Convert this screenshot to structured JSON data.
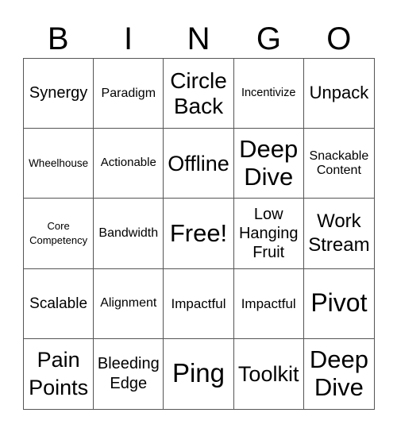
{
  "header": [
    "B",
    "I",
    "N",
    "G",
    "O"
  ],
  "cells": [
    [
      "Synergy",
      "Paradigm",
      "Circle Back",
      "Incentivize",
      "Unpack"
    ],
    [
      "Wheelhouse",
      "Actionable",
      "Offline",
      "Deep Dive",
      "Snackable Content"
    ],
    [
      "Core Competency",
      "Bandwidth",
      "Free!",
      "Low Hanging Fruit",
      "Work Stream"
    ],
    [
      "Scalable",
      "Alignment",
      "Impactful",
      "Impactful",
      "Pivot"
    ],
    [
      "Pain Points",
      "Bleeding Edge",
      "Ping",
      "Toolkit",
      "Deep Dive"
    ]
  ]
}
